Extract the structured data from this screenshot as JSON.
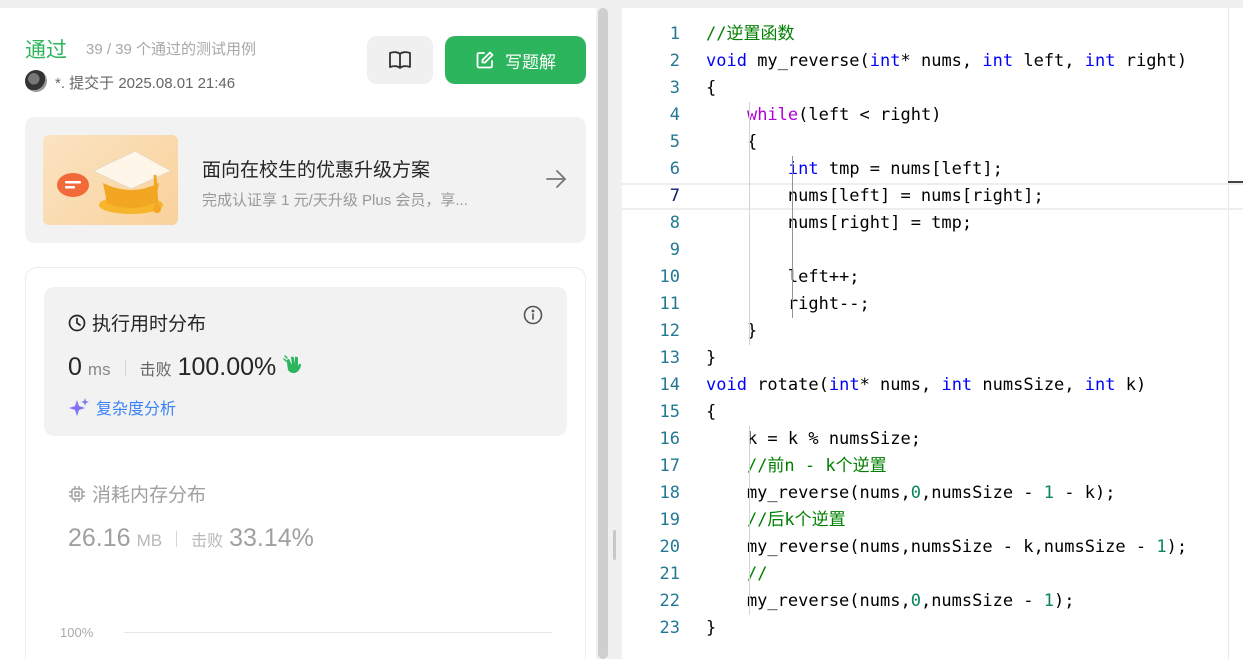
{
  "submission": {
    "status": "通过",
    "tests": "39 / 39 个通过的测试用例",
    "submit_info": "*. 提交于 2025.08.01 21:46",
    "solution_button": "写题解"
  },
  "promo": {
    "title": "面向在校生的优惠升级方案",
    "desc": "完成认证享 1 元/天升级 Plus 会员，享..."
  },
  "runtime": {
    "title": "执行用时分布",
    "value": "0",
    "unit": "ms",
    "beat_label": "击败",
    "beat_value": "100.00%",
    "complexity_link": "复杂度分析"
  },
  "memory": {
    "title": "消耗内存分布",
    "value": "26.16",
    "unit": "MB",
    "beat_label": "击败",
    "beat_value": "33.14%",
    "axis_label": "100%"
  },
  "colors": {
    "accent_green": "#2db55d",
    "keyword_blue": "#0000ff",
    "control_purple": "#af00db",
    "comment_green": "#008000",
    "number_green": "#098658",
    "type_teal": "#267f99",
    "line_number": "#237893"
  },
  "code": {
    "active_line": 7,
    "lines": [
      [
        [
          "//逆置函数",
          "c"
        ]
      ],
      [
        [
          "void",
          "k"
        ],
        [
          " my_reverse(",
          "p"
        ],
        [
          "int",
          "k"
        ],
        [
          "* nums, ",
          "p"
        ],
        [
          "int",
          "k"
        ],
        [
          " left, ",
          "p"
        ],
        [
          "int",
          "k"
        ],
        [
          " right)",
          "p"
        ]
      ],
      [
        [
          "{",
          "p"
        ]
      ],
      [
        [
          "    ",
          "p"
        ],
        [
          "while",
          "w"
        ],
        [
          "(left < right)",
          "p"
        ]
      ],
      [
        [
          "    {",
          "p"
        ]
      ],
      [
        [
          "        ",
          "p"
        ],
        [
          "int",
          "k"
        ],
        [
          " tmp = nums[left];",
          "p"
        ]
      ],
      [
        [
          "        nums[left] = nums[right];",
          "p"
        ]
      ],
      [
        [
          "        nums[right] = tmp;",
          "p"
        ]
      ],
      [
        [
          "",
          "p"
        ]
      ],
      [
        [
          "        left++;",
          "p"
        ]
      ],
      [
        [
          "        right--;",
          "p"
        ]
      ],
      [
        [
          "    }",
          "p"
        ]
      ],
      [
        [
          "}",
          "p"
        ]
      ],
      [
        [
          "void",
          "k"
        ],
        [
          " rotate(",
          "p"
        ],
        [
          "int",
          "k"
        ],
        [
          "* nums, ",
          "p"
        ],
        [
          "int",
          "k"
        ],
        [
          " numsSize, ",
          "p"
        ],
        [
          "int",
          "k"
        ],
        [
          " k)",
          "p"
        ]
      ],
      [
        [
          "{",
          "p"
        ]
      ],
      [
        [
          "    k = k % numsSize;",
          "p"
        ]
      ],
      [
        [
          "    ",
          "p"
        ],
        [
          "//前n - k个逆置",
          "c"
        ]
      ],
      [
        [
          "    my_reverse(nums,",
          "p"
        ],
        [
          "0",
          "n"
        ],
        [
          ",numsSize - ",
          "p"
        ],
        [
          "1",
          "n"
        ],
        [
          " - k);",
          "p"
        ]
      ],
      [
        [
          "    ",
          "p"
        ],
        [
          "//后k个逆置",
          "c"
        ]
      ],
      [
        [
          "    my_reverse(nums,numsSize - k,numsSize - ",
          "p"
        ],
        [
          "1",
          "n"
        ],
        [
          ");",
          "p"
        ]
      ],
      [
        [
          "    ",
          "p"
        ],
        [
          "//",
          "c"
        ]
      ],
      [
        [
          "    my_reverse(nums,",
          "p"
        ],
        [
          "0",
          "n"
        ],
        [
          ",numsSize - ",
          "p"
        ],
        [
          "1",
          "n"
        ],
        [
          ");",
          "p"
        ]
      ],
      [
        [
          "}",
          "p"
        ]
      ]
    ]
  }
}
